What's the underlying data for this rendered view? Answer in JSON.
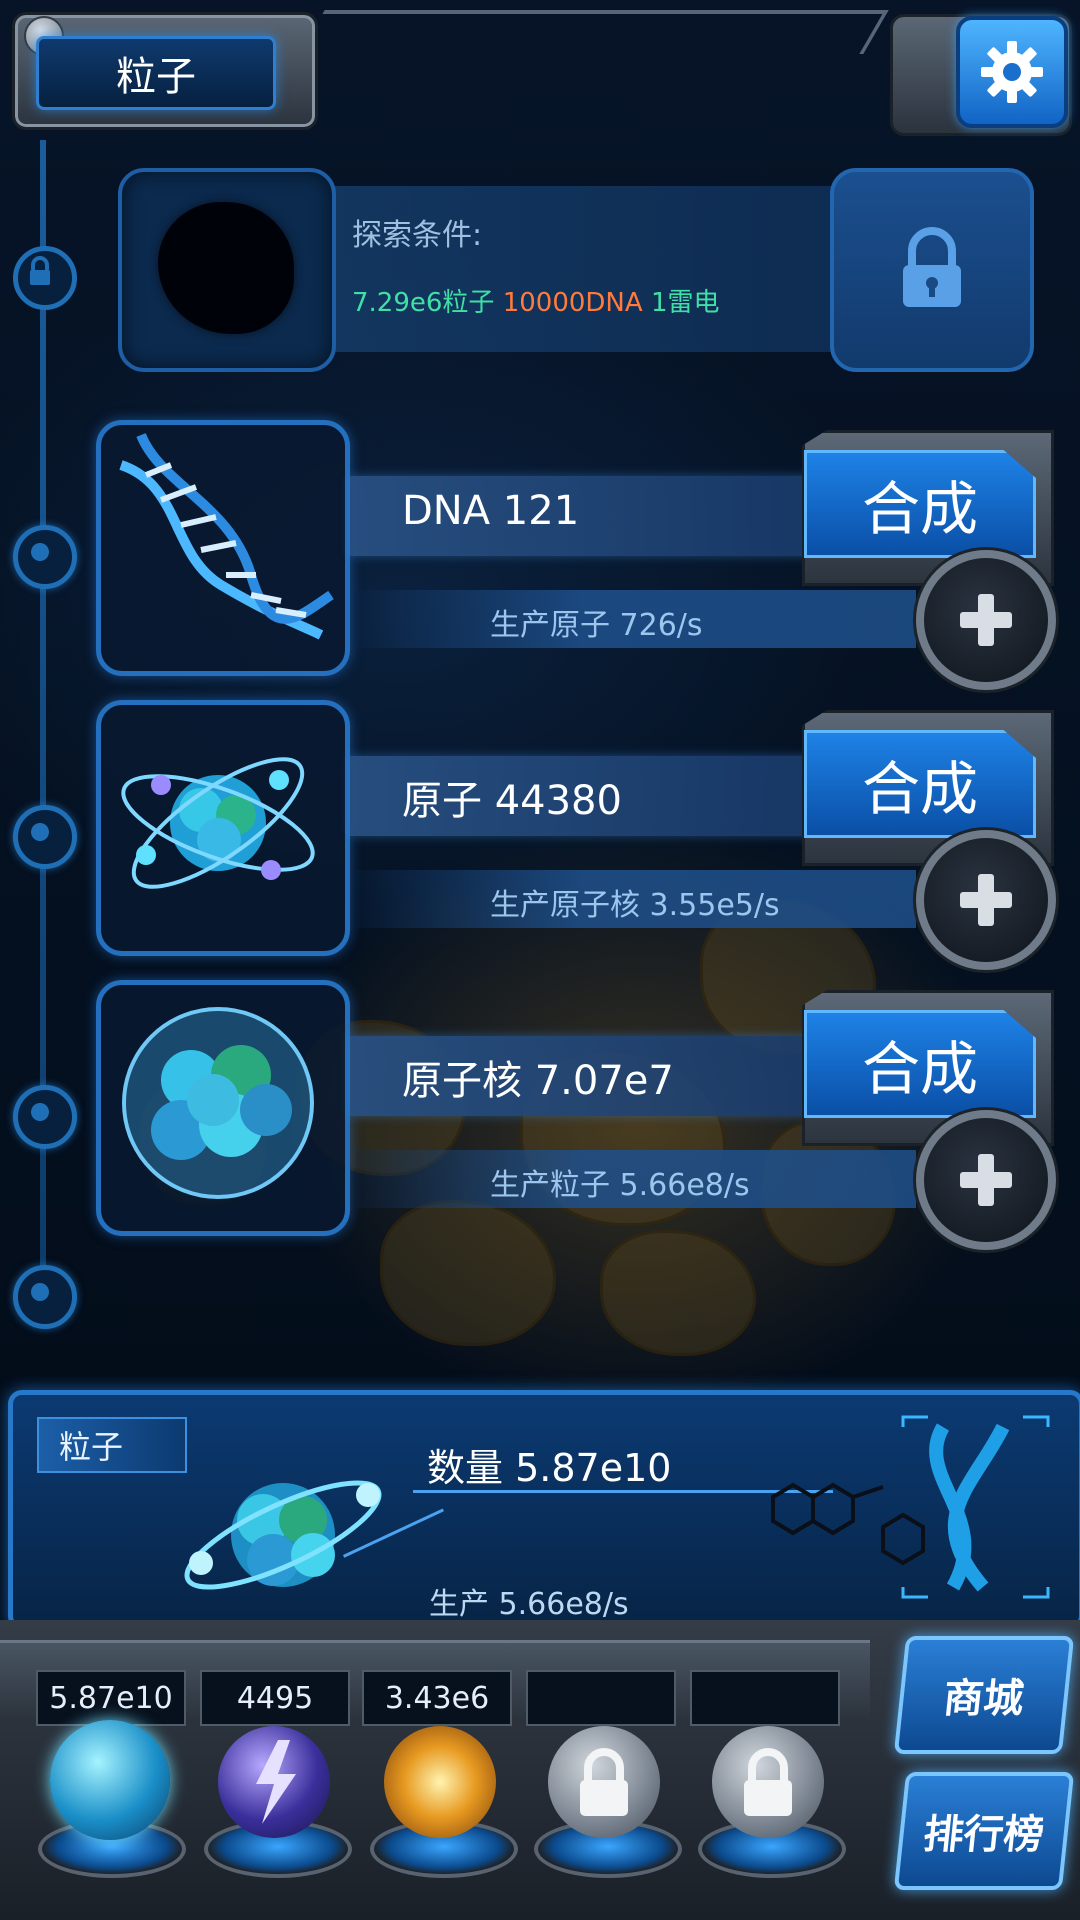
{
  "header": {
    "title": "粒子",
    "settings_icon": "gear-icon"
  },
  "explore": {
    "label": "探索条件:",
    "conditions": [
      {
        "text": "7.29e6粒子",
        "color": "#3fe0a6"
      },
      {
        "text": "10000DNA",
        "color": "#ff7a3d"
      },
      {
        "text": "1雷电",
        "color": "#3fe0a6"
      }
    ]
  },
  "items": [
    {
      "name": "DNA 121",
      "synth_label": "合成",
      "produce": "生产原子 726/s",
      "icon": "dna-helix-icon"
    },
    {
      "name": "原子 44380",
      "synth_label": "合成",
      "produce": "生产原子核 3.55e5/s",
      "icon": "atom-icon"
    },
    {
      "name": "原子核 7.07e7",
      "synth_label": "合成",
      "produce": "生产粒子 5.66e8/s",
      "icon": "nucleus-icon"
    }
  ],
  "info_panel": {
    "tag": "粒子",
    "quantity": "数量 5.87e10",
    "production": "生产 5.66e8/s"
  },
  "resources": {
    "slots": [
      "5.87e10",
      "4495",
      "3.43e6",
      "",
      ""
    ]
  },
  "side_buttons": {
    "shop": "商城",
    "rank": "排行榜"
  },
  "colors": {
    "accent": "#2f8fe8",
    "panel": "#0b3a72"
  }
}
